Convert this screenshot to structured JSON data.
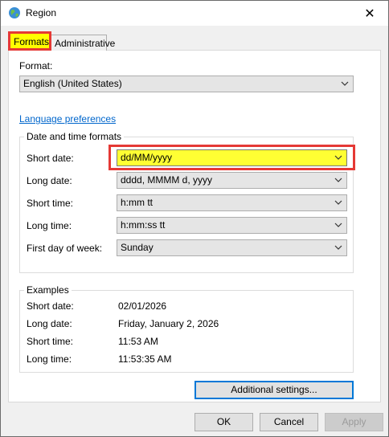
{
  "window": {
    "title": "Region",
    "close_glyph": "✕"
  },
  "tabs": [
    {
      "label": "Formats",
      "active": true
    },
    {
      "label": "Administrative",
      "active": false
    }
  ],
  "format": {
    "label": "Format:",
    "value": "English (United States)"
  },
  "language_link": "Language preferences",
  "date_time_formats": {
    "title": "Date and time formats",
    "rows": [
      {
        "label": "Short date:",
        "value": "dd/MM/yyyy"
      },
      {
        "label": "Long date:",
        "value": "dddd, MMMM d, yyyy"
      },
      {
        "label": "Short time:",
        "value": "h:mm tt"
      },
      {
        "label": "Long time:",
        "value": "h:mm:ss tt"
      },
      {
        "label": "First day of week:",
        "value": "Sunday"
      }
    ]
  },
  "examples": {
    "title": "Examples",
    "rows": [
      {
        "label": "Short date:",
        "value": "02/01/2026"
      },
      {
        "label": "Long date:",
        "value": "Friday, January 2, 2026"
      },
      {
        "label": "Short time:",
        "value": "11:53 AM"
      },
      {
        "label": "Long time:",
        "value": "11:53:35 AM"
      }
    ]
  },
  "buttons": {
    "additional": "Additional settings...",
    "ok": "OK",
    "cancel": "Cancel",
    "apply": "Apply"
  },
  "colors": {
    "highlight": "#ffff33",
    "annotation_border": "#e53935",
    "link": "#0066cc"
  }
}
